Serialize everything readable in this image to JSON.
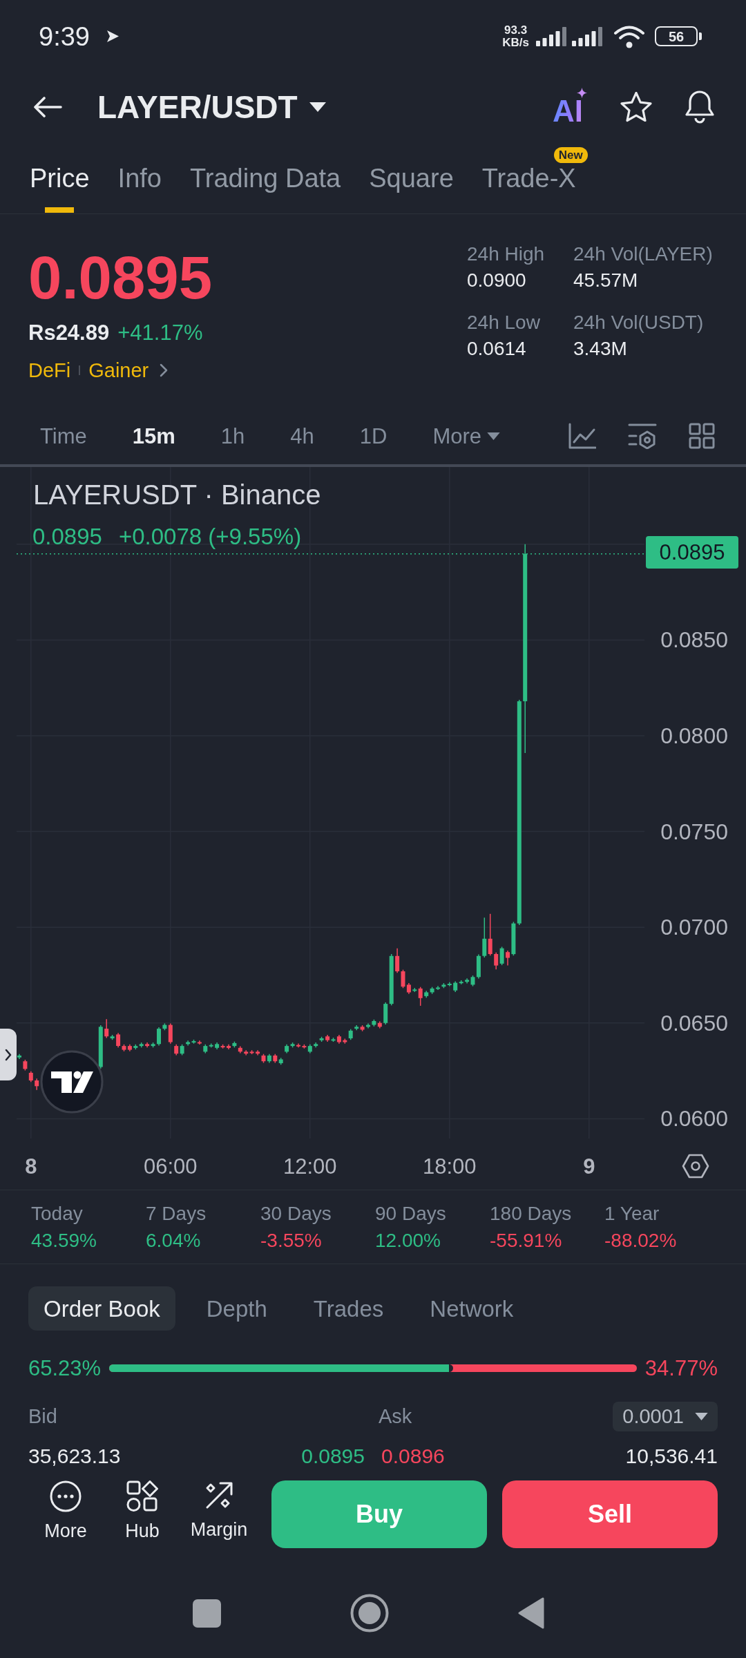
{
  "status_bar": {
    "time": "9:39",
    "network_speed": "93.3",
    "network_speed_unit": "KB/s",
    "battery": "56"
  },
  "header": {
    "title": "LAYER/USDT",
    "ai_label": "AI"
  },
  "tabs": [
    {
      "label": "Price",
      "selected": true
    },
    {
      "label": "Info",
      "selected": false
    },
    {
      "label": "Trading Data",
      "selected": false
    },
    {
      "label": "Square",
      "selected": false
    },
    {
      "label": "Trade-X",
      "selected": false,
      "badge": "New"
    }
  ],
  "price": {
    "last": "0.0895",
    "last_rising": false,
    "fiat": "Rs24.89",
    "change": "+41.17%",
    "change_rising": true,
    "tags": [
      "DeFi",
      "Gainer"
    ]
  },
  "stats": [
    {
      "label": "24h High",
      "value": "0.0900"
    },
    {
      "label": "24h Vol(LAYER)",
      "value": "45.57M"
    },
    {
      "label": "24h Low",
      "value": "0.0614"
    },
    {
      "label": "24h Vol(USDT)",
      "value": "3.43M"
    }
  ],
  "intervals": [
    {
      "label": "Time",
      "kind": "option",
      "selected": false
    },
    {
      "label": "15m",
      "kind": "option",
      "selected": true
    },
    {
      "label": "1h",
      "kind": "option",
      "selected": false
    },
    {
      "label": "4h",
      "kind": "option",
      "selected": false
    },
    {
      "label": "1D",
      "kind": "option",
      "selected": false
    },
    {
      "label": "More",
      "kind": "menu",
      "selected": false
    }
  ],
  "chart": {
    "title": "LAYERUSDT · Binance",
    "legend_price": "0.0895",
    "legend_change": "+0.0078 (+9.55%)",
    "legend_rising": true,
    "price_tag": "0.0895",
    "y_axis_labels": [
      "0.0850",
      "0.0800",
      "0.0750",
      "0.0700",
      "0.0650",
      "0.0600"
    ],
    "x_axis_labels": [
      {
        "text": "8",
        "kind": "day"
      },
      {
        "text": "06:00",
        "kind": "time"
      },
      {
        "text": "12:00",
        "kind": "time"
      },
      {
        "text": "18:00",
        "kind": "time"
      },
      {
        "text": "9",
        "kind": "day"
      }
    ]
  },
  "performance": [
    {
      "period": "Today",
      "change": "43.59%",
      "rising": true
    },
    {
      "period": "7 Days",
      "change": "6.04%",
      "rising": true
    },
    {
      "period": "30 Days",
      "change": "-3.55%",
      "rising": false
    },
    {
      "period": "90 Days",
      "change": "12.00%",
      "rising": true
    },
    {
      "period": "180 Days",
      "change": "-55.91%",
      "rising": false
    },
    {
      "period": "1 Year",
      "change": "-88.02%",
      "rising": false
    }
  ],
  "order_book": {
    "tabs": [
      {
        "label": "Order Book",
        "selected": true
      },
      {
        "label": "Depth",
        "selected": false
      },
      {
        "label": "Trades",
        "selected": false
      },
      {
        "label": "Network",
        "selected": false
      }
    ],
    "bid_share": "65.23%",
    "ask_share": "34.77%",
    "ratio": {
      "level": 0.6523
    },
    "bid_header": "Bid",
    "ask_header": "Ask",
    "precision": "0.0001",
    "rows": [
      {
        "bid_amount": "35,623.13",
        "bid_price": "0.0895",
        "ask_price": "0.0896",
        "ask_amount": "10,536.41"
      }
    ]
  },
  "actions": [
    {
      "label": "More",
      "kind": "more"
    },
    {
      "label": "Hub",
      "kind": "hub"
    },
    {
      "label": "Margin",
      "kind": "margin"
    }
  ],
  "buy_button": "Buy",
  "sell_button": "Sell"
}
